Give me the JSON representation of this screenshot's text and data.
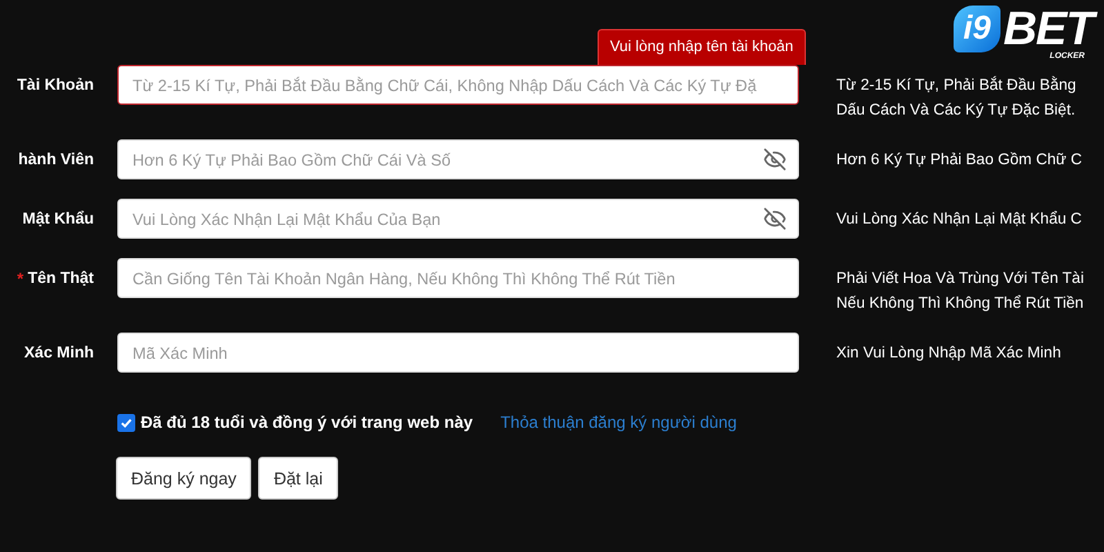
{
  "logo": {
    "mark": "i9",
    "name": "BET",
    "sub": "LOCKER"
  },
  "tooltip": "Vui lòng nhập tên tài khoản",
  "fields": [
    {
      "label": "Tài Khoản",
      "placeholder": "Từ 2-15 Kí Tự, Phải Bắt Đầu Bằng Chữ Cái, Không Nhập Dấu Cách Và Các Ký Tự Đặ",
      "error": true,
      "password": false,
      "hint": [
        "Từ 2-15 Kí Tự, Phải Bắt Đầu Bằng",
        "Dấu Cách Và Các Ký Tự Đặc Biệt."
      ]
    },
    {
      "label": "hành Viên",
      "placeholder": "Hơn 6 Ký Tự Phải Bao Gồm Chữ Cái Và Số",
      "error": false,
      "password": true,
      "hint": [
        "Hơn 6 Ký Tự Phải Bao Gồm Chữ C"
      ]
    },
    {
      "label": "Mật Khẩu",
      "placeholder": "Vui Lòng Xác Nhận Lại Mật Khẩu Của Bạn",
      "error": false,
      "password": true,
      "hint": [
        "Vui Lòng Xác Nhận Lại Mật Khẩu C"
      ]
    },
    {
      "label": "Tên Thật",
      "marker": "*",
      "placeholder": "Cần Giống Tên Tài Khoản Ngân Hàng, Nếu Không Thì Không Thể Rút Tiền",
      "error": false,
      "password": false,
      "hint": [
        "Phải Viết Hoa Và Trùng Với Tên Tài",
        "Nếu Không Thì Không Thể Rút Tiền"
      ]
    },
    {
      "label": "Xác Minh",
      "placeholder": "Mã Xác Minh",
      "error": false,
      "password": false,
      "hint": [
        "Xin Vui Lòng Nhập Mã Xác Minh"
      ]
    }
  ],
  "agree": {
    "label": "Đã đủ 18 tuổi và đồng ý với trang web này",
    "checked": true,
    "link": "Thỏa thuận đăng ký người dùng"
  },
  "buttons": [
    "Đăng ký ngay",
    "Đặt lại"
  ]
}
